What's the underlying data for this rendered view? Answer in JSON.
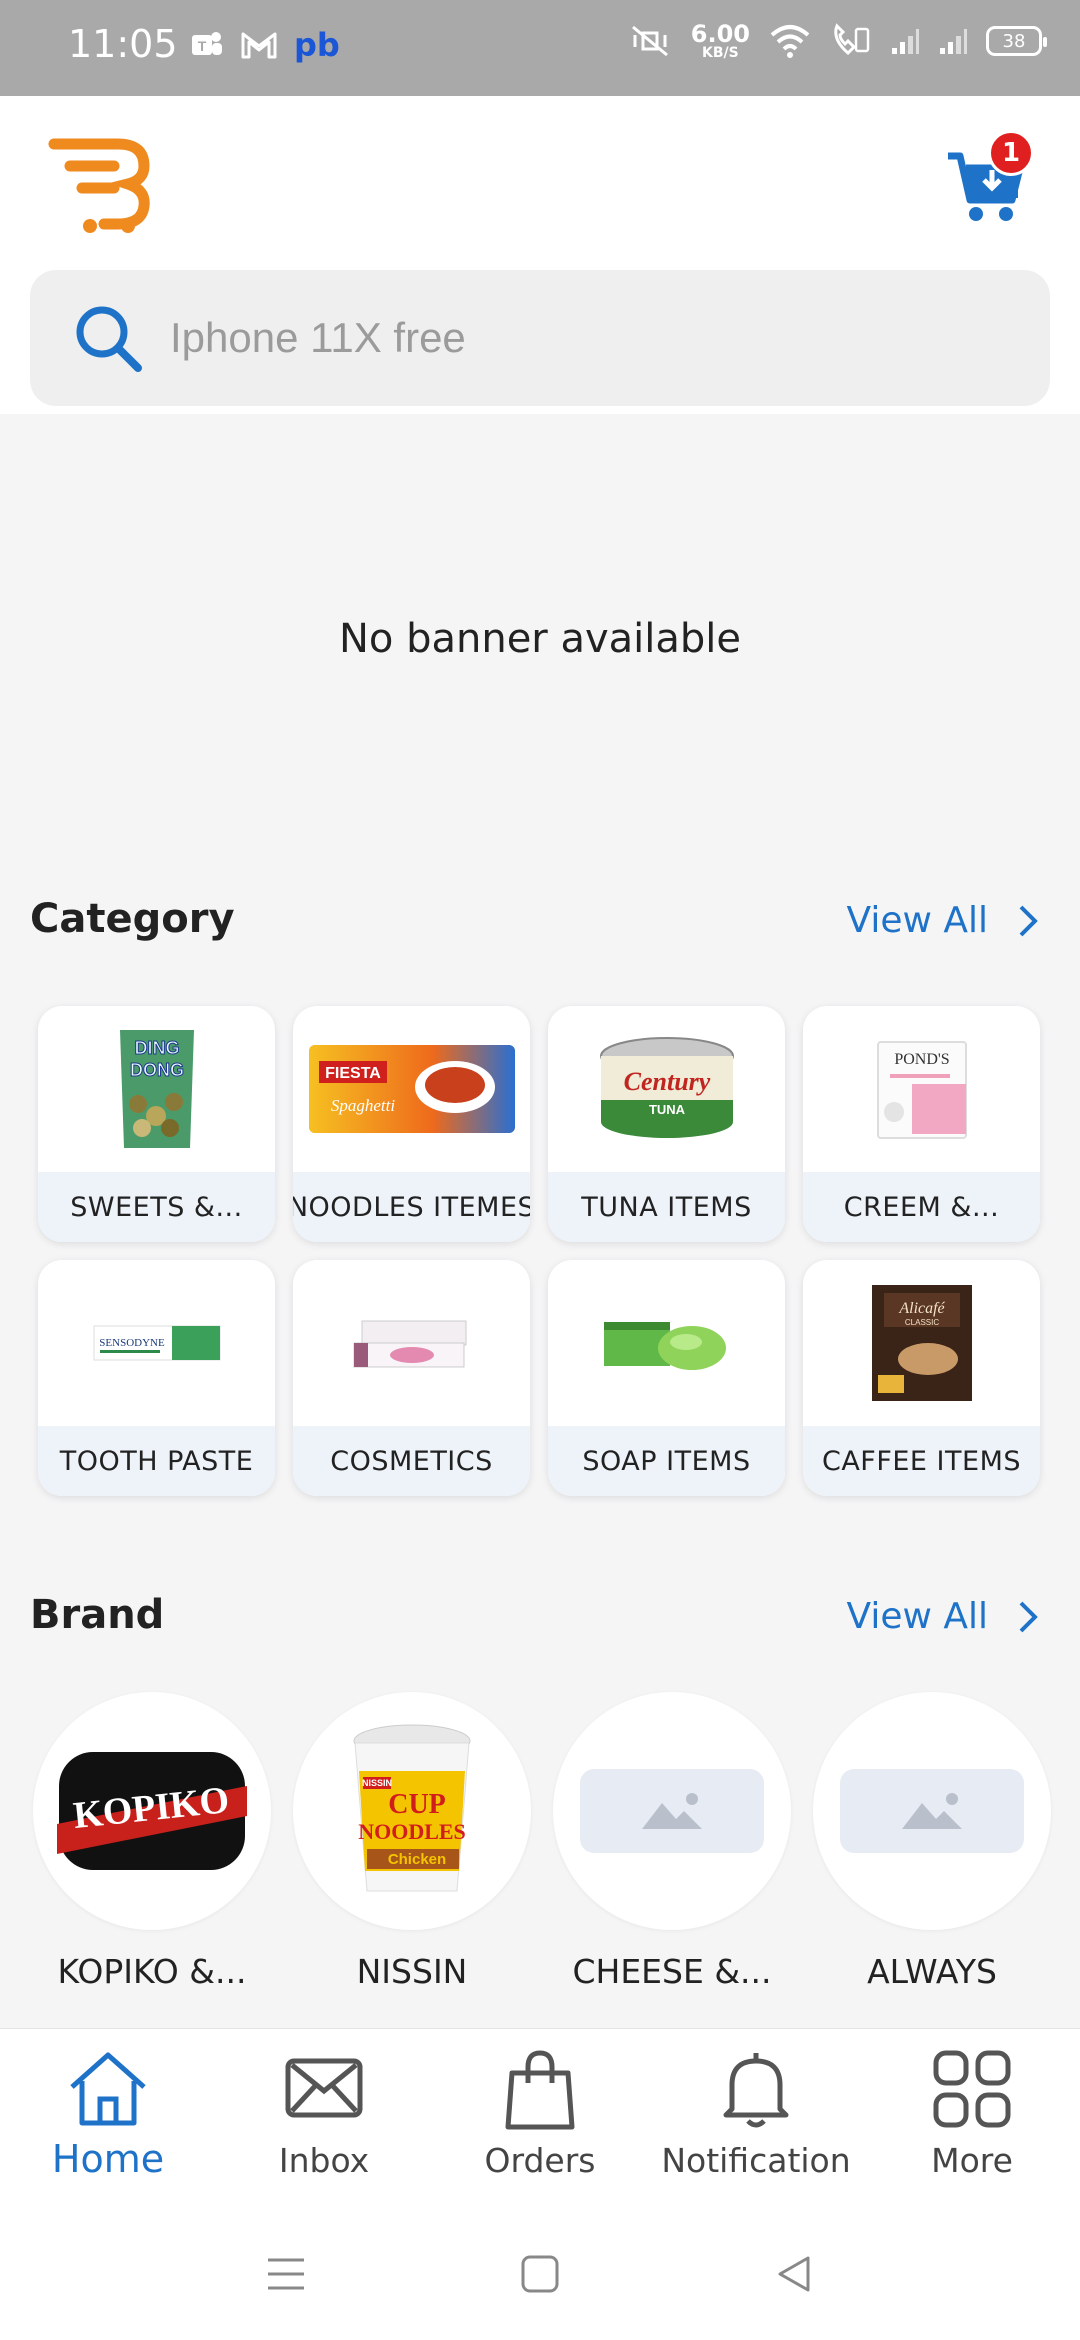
{
  "status_bar": {
    "time": "11:05",
    "carrier_text": "pb",
    "net_speed_value": "6.00",
    "net_speed_unit": "KB/S",
    "battery": "38"
  },
  "header": {
    "logo_icon": "brand-logo-icon",
    "cart_badge": "1",
    "colors": {
      "accent": "#1e73c8",
      "logo": "#ef8a1f",
      "badge": "#e02020"
    }
  },
  "search": {
    "placeholder": "Iphone 11X free",
    "value": ""
  },
  "banner": {
    "text": "No banner available"
  },
  "category": {
    "title": "Category",
    "view_all": "View All",
    "items": [
      {
        "label": "SWEETS &...",
        "icon": "snack-bag"
      },
      {
        "label": "NOODLES ITEMES",
        "icon": "spaghetti-pack"
      },
      {
        "label": "TUNA ITEMS",
        "icon": "tuna-can"
      },
      {
        "label": "CREEM &...",
        "icon": "cream-box"
      },
      {
        "label": "TOOTH PASTE",
        "icon": "toothpaste"
      },
      {
        "label": "COSMETICS",
        "icon": "cosmetic-tube"
      },
      {
        "label": "SOAP ITEMS",
        "icon": "soap-bar"
      },
      {
        "label": "CAFFEE ITEMS",
        "icon": "coffee-pack"
      }
    ],
    "image_text": {
      "ding": "DING",
      "dong": "DONG",
      "fiesta": "FIESTA",
      "spaghetti": "Spaghetti",
      "century": "Century",
      "tuna": "TUNA",
      "ponds": "POND'S",
      "sensodyne": "SENSODYNE",
      "alicafe": "Alicafé",
      "classic": "CLASSIC"
    }
  },
  "brand": {
    "title": "Brand",
    "view_all": "View All",
    "items": [
      {
        "label": "KOPIKO &...",
        "logo_text": "KOPIKO"
      },
      {
        "label": "NISSIN",
        "logo_text": "CUP NOODLES"
      },
      {
        "label": "CHEESE &...",
        "logo_text": ""
      },
      {
        "label": "ALWAYS",
        "logo_text": ""
      }
    ],
    "image_text": {
      "nissin": "NISSIN",
      "cup": "CUP",
      "noodles": "NOODLES",
      "chicken": "Chicken"
    }
  },
  "bottom_nav": [
    {
      "label": "Home",
      "icon": "home-icon",
      "active": true
    },
    {
      "label": "Inbox",
      "icon": "mail-icon",
      "active": false
    },
    {
      "label": "Orders",
      "icon": "shopping-bag-icon",
      "active": false
    },
    {
      "label": "Notification",
      "icon": "bell-icon",
      "active": false
    },
    {
      "label": "More",
      "icon": "grid-icon",
      "active": false
    }
  ]
}
